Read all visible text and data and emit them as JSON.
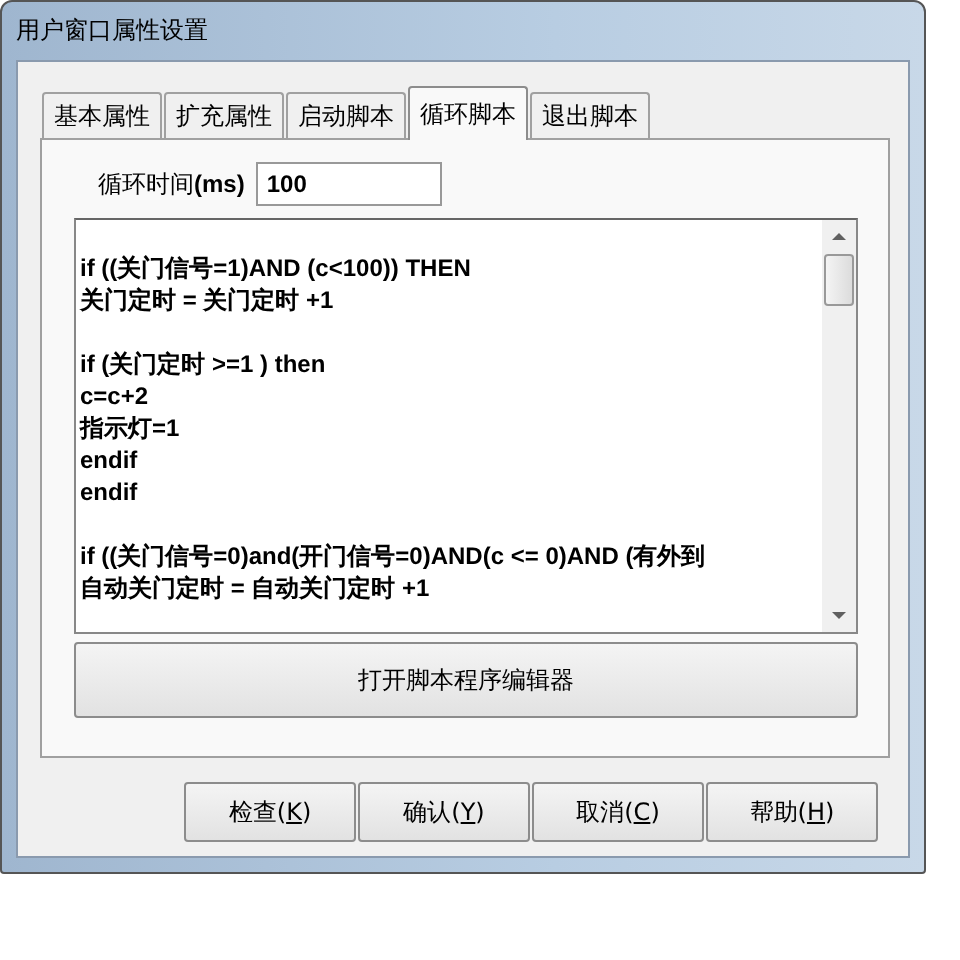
{
  "window": {
    "title": "用户窗口属性设置"
  },
  "tabs": [
    {
      "label": "基本属性",
      "selected": false
    },
    {
      "label": "扩充属性",
      "selected": false
    },
    {
      "label": "启动脚本",
      "selected": false
    },
    {
      "label": "循环脚本",
      "selected": true
    },
    {
      "label": "退出脚本",
      "selected": false
    }
  ],
  "cycle_time": {
    "label": "循环时间",
    "unit": "(ms)",
    "value": "100"
  },
  "script_blocks": [
    [
      "if ((关门信号=1)AND (c<100)) THEN",
      "关门定时 = 关门定时 +1"
    ],
    [
      "if (关门定时 >=1 ) then",
      "c=c+2",
      "指示灯=1",
      "endif",
      "endif"
    ],
    [
      "if ((关门信号=0)and(开门信号=0)AND(c <= 0)AND (有外到",
      "自动关门定时 = 自动关门定时 +1"
    ]
  ],
  "editor_button": "打开脚本程序编辑器",
  "buttons": [
    {
      "text": "检查(",
      "mnemonic": "K",
      "close": ")"
    },
    {
      "text": "确认(",
      "mnemonic": "Y",
      "close": ")"
    },
    {
      "text": "取消(",
      "mnemonic": "C",
      "close": ")"
    },
    {
      "text": "帮助(",
      "mnemonic": "H",
      "close": ")"
    }
  ]
}
